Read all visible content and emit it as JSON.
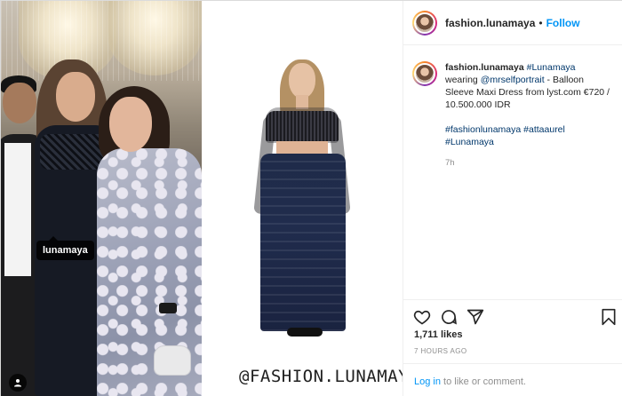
{
  "header": {
    "username": "fashion.lunamaya",
    "separator": "•",
    "follow_label": "Follow"
  },
  "media": {
    "tag_label": "lunamaya",
    "watermark": "@FASHION.LUNAMAYA"
  },
  "caption": {
    "username": "fashion.lunamaya",
    "mention_1": "#Lunamaya",
    "word_wearing": "wearing",
    "mention_2": "@mrselfportrait",
    "text_after_mention": " - Balloon Sleeve Maxi Dress from lyst.com €720 / 10.500.000 IDR",
    "hashtag_1": "#fashionlunamaya",
    "hashtag_2": "#attaaurel",
    "hashtag_3": "#Lunamaya",
    "relative_time": "7h"
  },
  "actions": {
    "like_icon": "heart-icon",
    "comment_icon": "comment-icon",
    "share_icon": "share-icon",
    "save_icon": "bookmark-icon"
  },
  "stats": {
    "likes": "1,711 likes",
    "timestamp": "7 HOURS AGO"
  },
  "footer": {
    "login_link": "Log in",
    "login_text": " to like or comment."
  },
  "colors": {
    "link_blue": "#0095f6",
    "mention_dark_blue": "#00376b",
    "text": "#262626",
    "muted": "#8e8e8e"
  }
}
